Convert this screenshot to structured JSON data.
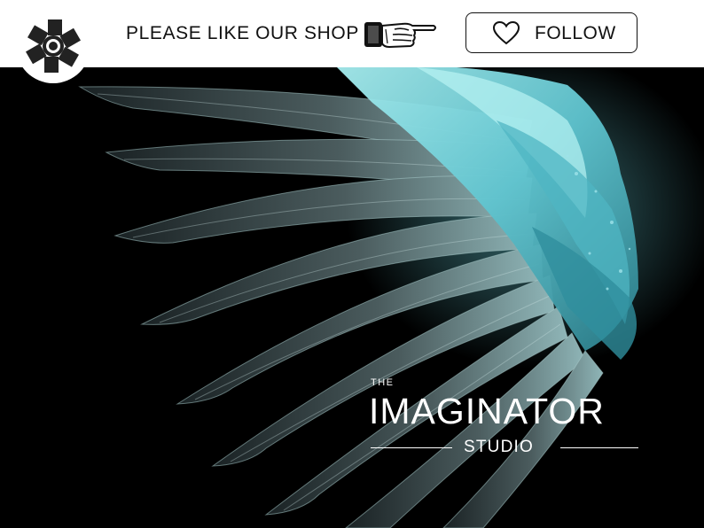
{
  "header": {
    "logo_icon": "camera-aperture-logo-icon",
    "tagline": "PLEASE LIKE OUR SHOP",
    "pointer_icon": "pointing-hand-icon",
    "follow_button": {
      "icon": "heart-icon",
      "label": "FOLLOW"
    }
  },
  "hero": {
    "image": "teal-and-dark-angel-wing-artwork",
    "brand": {
      "the": "THE",
      "name": "IMAGINATOR",
      "studio": "STUDIO"
    }
  },
  "colors": {
    "header_bg": "#ffffff",
    "hero_bg": "#000000",
    "wing_teal": "#7fd6dc",
    "wing_dark": "#3c4a4d",
    "text_dark": "#111111",
    "text_light": "#ffffff"
  }
}
